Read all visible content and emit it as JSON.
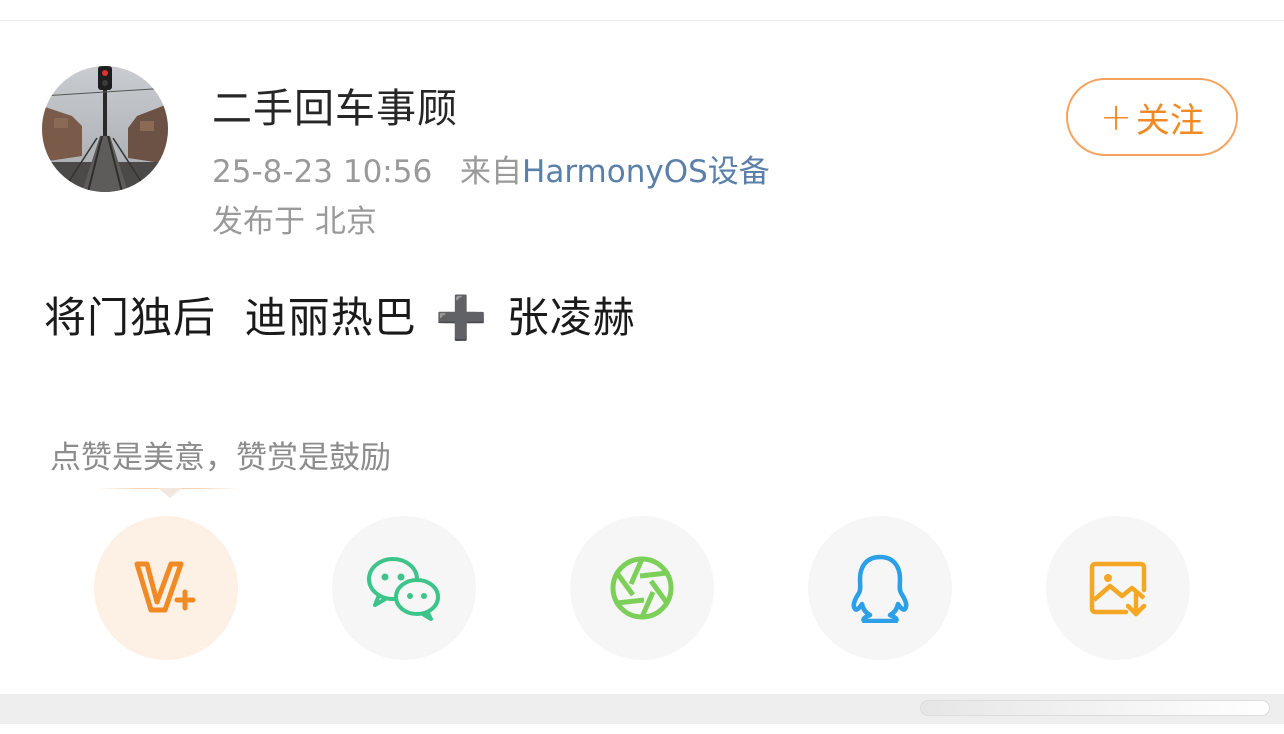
{
  "post": {
    "author": "二手回车事顾",
    "timestamp": "25-8-23 10:56",
    "source_prefix": "来自",
    "source": "HarmonyOS设备",
    "location": "发布于 北京",
    "text_part1": "将门独后  迪丽热巴",
    "text_plus": "➕",
    "text_part2": "张凌赫"
  },
  "follow": {
    "plus": "+",
    "label": "关注"
  },
  "reward": {
    "hint": "点赞是美意，赞赏是鼓励"
  },
  "share_icons": [
    "weibo-v-plus-icon",
    "wechat-icon",
    "moments-icon",
    "qq-icon",
    "save-image-icon"
  ],
  "colors": {
    "accent_orange": "#f08a24",
    "link_blue": "#5a7fa8",
    "wechat_green": "#3cc48b",
    "moments_green": "#7cd05a",
    "qq_blue": "#2b9fe8",
    "save_orange": "#f5a623"
  }
}
